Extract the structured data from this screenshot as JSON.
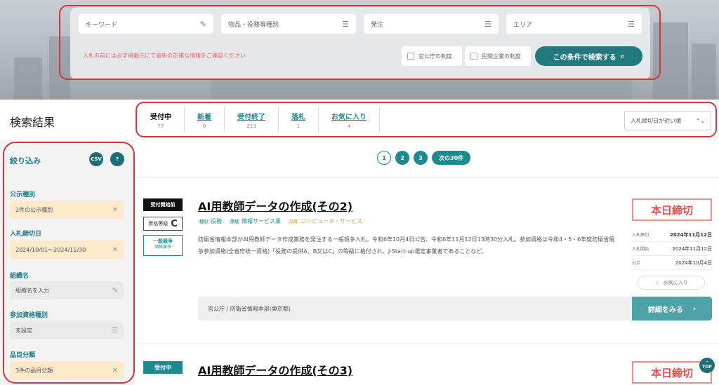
{
  "search": {
    "keyword_placeholder": "キーワード",
    "category_placeholder": "物品・役務等種別",
    "issuer_placeholder": "発注",
    "area_placeholder": "エリア",
    "notice": "入札の前には必ず掲載元にて最新の正確な情報をご確認ください",
    "check_gov": "官公庁の制度",
    "check_private": "民間企業の制度",
    "search_button": "この条件で検索する"
  },
  "results": {
    "title": "検索結果",
    "tabs": [
      {
        "label": "受付中",
        "count": "77"
      },
      {
        "label": "新着",
        "count": "0"
      },
      {
        "label": "受付終了",
        "count": "213"
      },
      {
        "label": "落札",
        "count": "1"
      },
      {
        "label": "お気に入り",
        "count": "4"
      }
    ],
    "sort": "入札締切日が近い順"
  },
  "sidebar": {
    "title": "絞り込み",
    "csv_label": "CSV",
    "help_label": "?",
    "filters": [
      {
        "label": "公示種別",
        "value": "2件の公示種別"
      },
      {
        "label": "入札締切日",
        "value": "2024/10/01〜2024/11/30"
      },
      {
        "label": "組織名",
        "value": "組織名を入力"
      },
      {
        "label": "参加資格種別",
        "value": "未設定"
      },
      {
        "label": "品目分類",
        "value": "3件の品目分類"
      }
    ]
  },
  "pager": {
    "pages": [
      "1",
      "2",
      "3"
    ],
    "next": "次の30件"
  },
  "card1": {
    "status": "受付開始前",
    "grade_label": "資格等級",
    "grade": "C",
    "method": "一般競争",
    "method_sub": "価格競争",
    "title": "AI用教師データの作成(その2)",
    "cat1_tag": "種別",
    "cat1": "役務",
    "cat2_tag": "業種",
    "cat2": "情報サービス業",
    "cat3_tag": "品目",
    "cat3": "コンピュータ・サービス",
    "description": "防衛省情報本部がAI用教師データ作成業務を発注する一般競争入札。令和6年10月4日公告、令和6年11月12日13時30分入札。参加資格は令和4・5・6年度防衛省競争参加資格(全省庁統一資格)「役務の提供A、B又はC」の等級に格付され、J-Start-up選定事業者であることなど。",
    "org": "官公庁 / 防衛省情報本部(東京都)",
    "detail_button": "詳細をみる",
    "deadline_badge": "本日締切",
    "dates": [
      {
        "label": "入札締切",
        "value": "2024年11月12日"
      },
      {
        "label": "入札開始",
        "value": "2024年11月12日"
      },
      {
        "label": "公示",
        "value": "2024年10月4日"
      }
    ],
    "fav": "お気に入り"
  },
  "card2": {
    "status": "受付中",
    "title": "AI用教師データの作成(その3)",
    "deadline_badge": "本日締切"
  },
  "top_button": "TOP"
}
